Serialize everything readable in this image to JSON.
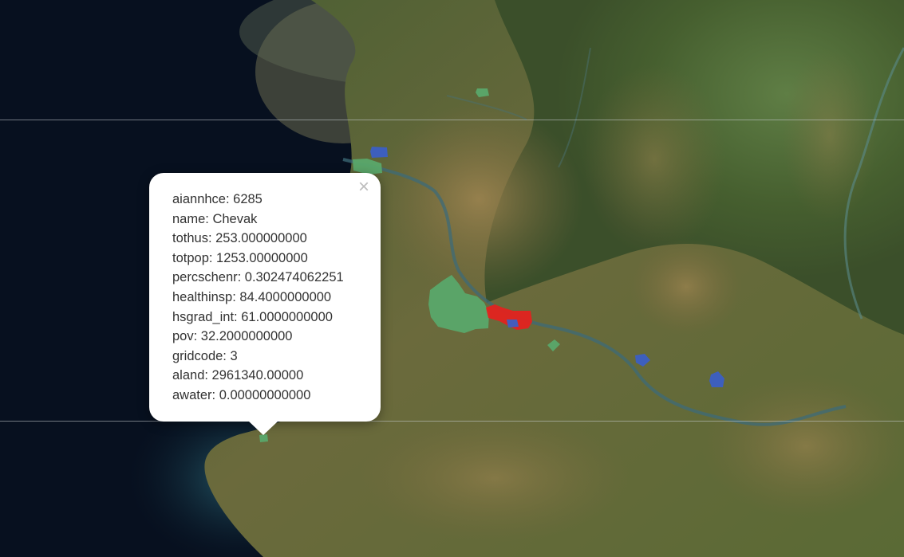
{
  "map": {
    "basemap": "satellite imagery",
    "colors": {
      "ocean": "#07101f",
      "land_green": "#3f5a2e",
      "land_tan": "#8a7346",
      "feature_green": "#5aa86a",
      "feature_blue": "#3b5fc4",
      "feature_red": "#e3231f"
    },
    "features": [
      {
        "name": "feature-green",
        "color": "green"
      },
      {
        "name": "feature-blue",
        "color": "blue"
      },
      {
        "name": "feature-red",
        "color": "red"
      }
    ]
  },
  "popup": {
    "close_symbol": "×",
    "fields": [
      {
        "key": "aiannhce",
        "value": "6285",
        "text": "aiannhce: 6285"
      },
      {
        "key": "name",
        "value": "Chevak",
        "text": "name: Chevak"
      },
      {
        "key": "tothus",
        "value": "253.000000000",
        "text": "tothus: 253.000000000"
      },
      {
        "key": "totpop",
        "value": "1253.00000000",
        "text": "totpop: 1253.00000000"
      },
      {
        "key": "percschenr",
        "value": "0.302474062251",
        "text": "percschenr: 0.302474062251"
      },
      {
        "key": "healthinsp",
        "value": "84.4000000000",
        "text": "healthinsp: 84.4000000000"
      },
      {
        "key": "hsgrad_int",
        "value": "61.0000000000",
        "text": "hsgrad_int: 61.0000000000"
      },
      {
        "key": "pov",
        "value": "32.2000000000",
        "text": "pov: 32.2000000000"
      },
      {
        "key": "gridcode",
        "value": "3",
        "text": "gridcode: 3"
      },
      {
        "key": "aland",
        "value": "2961340.00000",
        "text": "aland: 2961340.00000"
      },
      {
        "key": "awater",
        "value": "0.00000000000",
        "text": "awater: 0.00000000000"
      }
    ]
  }
}
